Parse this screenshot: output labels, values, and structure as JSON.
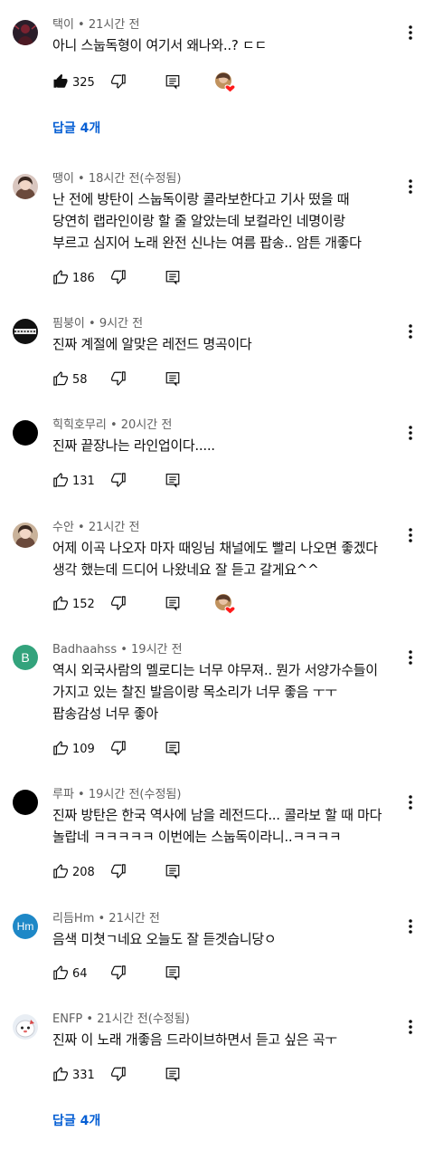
{
  "comments": [
    {
      "author": "택이",
      "time": "21시간 전",
      "text": "아니 스눕독형이 여기서 왜나와..? ㄷㄷ",
      "likes": "325",
      "liked": true,
      "hearted": true,
      "replies": "답글 4개",
      "avatar_color": "#2a1e2a",
      "avatar_icon": "figure-avatar"
    },
    {
      "author": "땡이",
      "time": "18시간 전(수정됨)",
      "text": "난 전에 방탄이 스눕독이랑 콜라보한다고 기사 떴을 때\n당연히 랩라인이랑 할 줄 알았는데 보컬라인 네명이랑\n부르고 심지어 노래 완전 신나는 여름 팝송.. 암튼 개좋다",
      "likes": "186",
      "liked": false,
      "hearted": false,
      "replies": "",
      "avatar_color": "#d9c6bf",
      "avatar_icon": "face-avatar"
    },
    {
      "author": "핌붕이",
      "time": "9시간 전",
      "text": "진짜 계절에 알맞은 레전드 명곡이다",
      "likes": "58",
      "liked": false,
      "hearted": false,
      "replies": "",
      "avatar_color": "#111111",
      "avatar_icon": "pattern-avatar"
    },
    {
      "author": "힉힉호무리",
      "time": "20시간 전",
      "text": "진짜 끝장나는 라인업이다.....",
      "likes": "131",
      "liked": false,
      "hearted": false,
      "replies": "",
      "avatar_color": "#000000",
      "avatar_icon": "black-avatar"
    },
    {
      "author": "수안",
      "time": "21시간 전",
      "text": "어제 이곡 나오자 마자 때잉님 채널에도 빨리 나오면 좋겠다\n생각 했는데 드디어 나왔네요 잘 듣고 갈게요^^",
      "likes": "152",
      "liked": false,
      "hearted": true,
      "replies": "",
      "avatar_color": "#c9b29a",
      "avatar_icon": "face-avatar"
    },
    {
      "author": "Badhaahss",
      "time": "19시간 전",
      "text": "역시 외국사람의 멜로디는 너무 야무져.. 뭔가 서양가수들이\n가지고 있는 찰진 발음이랑 목소리가 너무 좋음 ㅜㅜ\n팝송감성 너무 좋아",
      "likes": "109",
      "liked": false,
      "hearted": false,
      "replies": "",
      "avatar_color": "#33a37c",
      "avatar_icon": "letter-avatar",
      "avatar_letter": "B"
    },
    {
      "author": "루파",
      "time": "19시간 전(수정됨)",
      "text": "진짜 방탄은 한국 역사에 남을 레전드다... 콜라보 할 때 마다\n놀랍네 ㅋㅋㅋㅋㅋ 이번에는 스눕독이라니..ㅋㅋㅋㅋ",
      "likes": "208",
      "liked": false,
      "hearted": false,
      "replies": "",
      "avatar_color": "#000000",
      "avatar_icon": "black-avatar"
    },
    {
      "author": "리듬Hm",
      "time": "21시간 전",
      "text": "음색 미쳣ㄱ네요 오늘도 잘 듣겟습니당ㅇ",
      "likes": "64",
      "liked": false,
      "hearted": false,
      "replies": "",
      "avatar_color": "#1e88c7",
      "avatar_icon": "letter-avatar",
      "avatar_letter": "Hm"
    },
    {
      "author": "ENFP",
      "time": "21시간 전(수정됨)",
      "text": "진짜 이 노래 개좋음 드라이브하면서 듣고 싶은 곡ㅜ",
      "likes": "331",
      "liked": false,
      "hearted": false,
      "replies": "답글 4개",
      "avatar_color": "#e9eef4",
      "avatar_icon": "character-avatar"
    }
  ]
}
